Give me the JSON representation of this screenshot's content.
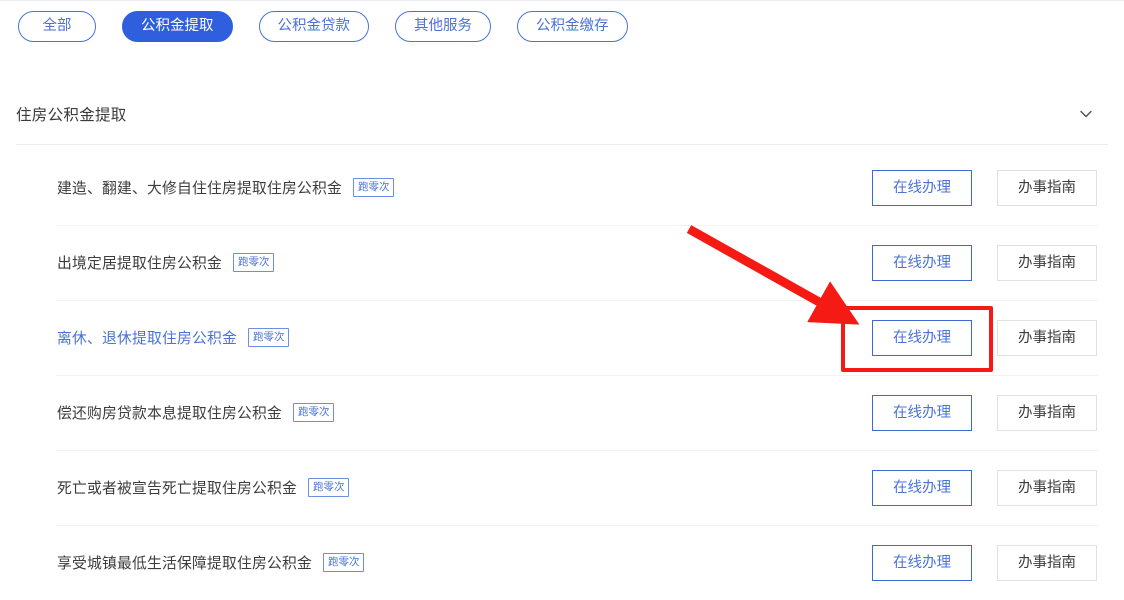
{
  "filters": {
    "items": [
      {
        "label": "全部",
        "active": false
      },
      {
        "label": "公积金提取",
        "active": true
      },
      {
        "label": "公积金贷款",
        "active": false
      },
      {
        "label": "其他服务",
        "active": false
      },
      {
        "label": "公积金缴存",
        "active": false
      }
    ]
  },
  "section": {
    "title": "住房公积金提取",
    "collapse_icon": "chevron-down-icon",
    "expanded": true
  },
  "actions": {
    "primary_label": "在线办理",
    "secondary_label": "办事指南"
  },
  "rows": [
    {
      "label": "建造、翻建、大修自住住房提取住房公积金",
      "badge": "跑零次",
      "highlight": false
    },
    {
      "label": "出境定居提取住房公积金",
      "badge": "跑零次",
      "highlight": false
    },
    {
      "label": "离休、退休提取住房公积金",
      "badge": "跑零次",
      "highlight": true
    },
    {
      "label": "偿还购房贷款本息提取住房公积金",
      "badge": "跑零次",
      "highlight": false
    },
    {
      "label": "死亡或者被宣告死亡提取住房公积金",
      "badge": "跑零次",
      "highlight": false
    },
    {
      "label": "享受城镇最低生活保障提取住房公积金",
      "badge": "跑零次",
      "highlight": false
    }
  ],
  "annotations": {
    "arrow_color": "#f51a14",
    "box_color": "#f51a14",
    "target_row_index": 2,
    "target_action": "在线办理"
  },
  "colors": {
    "accent_blue": "#4a73d6",
    "active_pill_blue": "#2f5fdd",
    "annotation_red": "#f51a14",
    "text_dark": "#3c3c3c",
    "divider": "#f1f2f4"
  }
}
